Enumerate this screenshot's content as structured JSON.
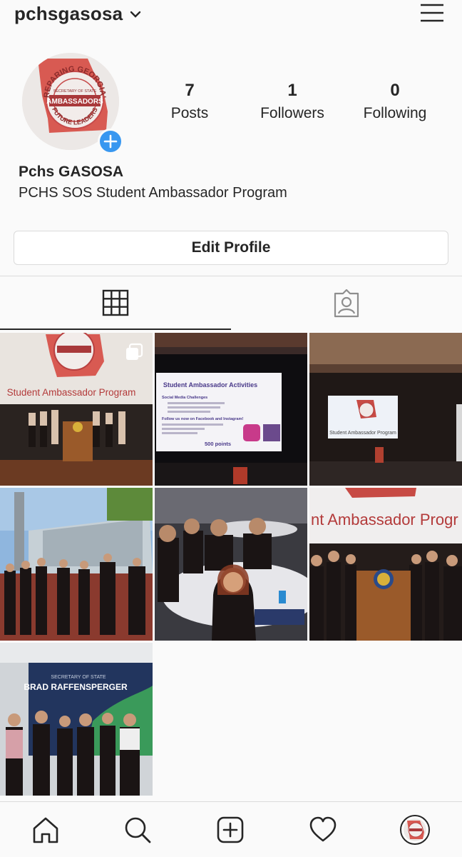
{
  "header": {
    "username": "pchsgasosa"
  },
  "profile": {
    "display_name": "Pchs GASOSA",
    "bio": "PCHS SOS Student Ambassador Program",
    "avatar_text": {
      "top": "PREPARING GEORGIA'S",
      "middle": "SECRETARY OF STATE",
      "main": "AMBASSADORS",
      "bottom": "FUTURE LEADERS"
    },
    "stats": [
      {
        "value": "7",
        "label": "Posts"
      },
      {
        "value": "1",
        "label": "Followers"
      },
      {
        "value": "0",
        "label": "Following"
      }
    ],
    "edit_label": "Edit Profile"
  },
  "posts": [
    {
      "caption": "Student Ambassador Program",
      "multi": true
    },
    {
      "caption": "Student Ambassador Activities",
      "slide_lines": [
        "Social Media Challenges",
        "Follow us now on Facebook and Instagram!",
        "500 points"
      ]
    },
    {
      "caption": "Student Ambassador Program"
    },
    {
      "caption": ""
    },
    {
      "caption": ""
    },
    {
      "caption": "nt Ambassador Progr"
    },
    {
      "caption": "BRAD RAFFENSPERGER",
      "sub": "SECRETARY OF STATE"
    }
  ],
  "colors": {
    "accent": "#3897f0",
    "text": "#262626",
    "border": "#dbdbdb",
    "brand_red": "#c8343a"
  }
}
